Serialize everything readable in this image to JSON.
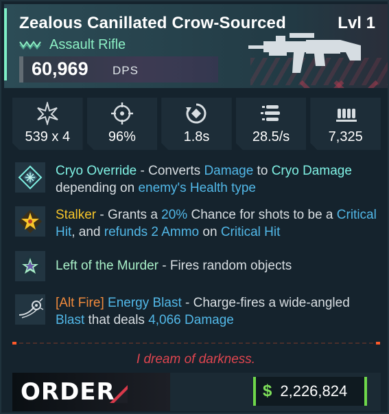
{
  "weapon": {
    "name": "Zealous Canillated Crow-Sourced",
    "level": "Lvl 1",
    "type": "Assault Rifle",
    "type_icon": "assault-rifle-chevrons-icon",
    "dps_value": "60,969",
    "dps_unit": "DPS",
    "image": "assault-rifle-silhouette-icon"
  },
  "stats": [
    {
      "icon": "damage-burst-icon",
      "value": "539 x 4"
    },
    {
      "icon": "accuracy-crosshair-icon",
      "value": "96%"
    },
    {
      "icon": "reload-time-icon",
      "value": "1.8s"
    },
    {
      "icon": "fire-rate-bullets-icon",
      "value": "28.5/s"
    },
    {
      "icon": "magazine-ammo-icon",
      "value": "7,325"
    }
  ],
  "perks": [
    {
      "icon": "cryo-diamond-icon",
      "segments": [
        {
          "text": "Cryo Override",
          "color": "teal"
        },
        {
          "text": " - Converts ",
          "color": "plain"
        },
        {
          "text": "Damage",
          "color": "blue"
        },
        {
          "text": " to ",
          "color": "plain"
        },
        {
          "text": "Cryo Damage",
          "color": "teal"
        },
        {
          "text": " depending on ",
          "color": "plain"
        },
        {
          "text": "enemy's Health type",
          "color": "blue"
        }
      ]
    },
    {
      "icon": "stalker-star-icon",
      "segments": [
        {
          "text": "Stalker",
          "color": "gold"
        },
        {
          "text": " - Grants a ",
          "color": "plain"
        },
        {
          "text": "20%",
          "color": "blue"
        },
        {
          "text": " Chance for shots to be a ",
          "color": "plain"
        },
        {
          "text": "Critical Hit",
          "color": "blue"
        },
        {
          "text": ", and ",
          "color": "plain"
        },
        {
          "text": "refunds 2 Ammo",
          "color": "blue"
        },
        {
          "text": " on ",
          "color": "plain"
        },
        {
          "text": "Critical Hit",
          "color": "blue"
        }
      ]
    },
    {
      "icon": "murder-star-icon",
      "segments": [
        {
          "text": "Left of the Murder",
          "color": "green"
        },
        {
          "text": " - Fires random objects",
          "color": "plain"
        }
      ]
    },
    {
      "icon": "energy-blast-icon",
      "segments": [
        {
          "text": "[Alt Fire]",
          "color": "orange"
        },
        {
          "text": " ",
          "color": "plain"
        },
        {
          "text": "Energy Blast",
          "color": "blue"
        },
        {
          "text": " - Charge-fires a wide-angled ",
          "color": "plain"
        },
        {
          "text": "Blast",
          "color": "blue"
        },
        {
          "text": " that deals ",
          "color": "plain"
        },
        {
          "text": "4,066 Damage",
          "color": "blue"
        }
      ]
    }
  ],
  "flavor_text": "I dream of darkness.",
  "footer": {
    "brand": "ORDER",
    "currency_symbol": "$",
    "price": "2,226,824"
  },
  "colors": {
    "accent_teal": "#7ff0e3",
    "keyword_blue": "#52b8e8",
    "legendary_gold": "#f7c52a",
    "alt_fire_orange": "#f08a3c",
    "flavor_red": "#e0454f",
    "money_green": "#6fd84a"
  }
}
